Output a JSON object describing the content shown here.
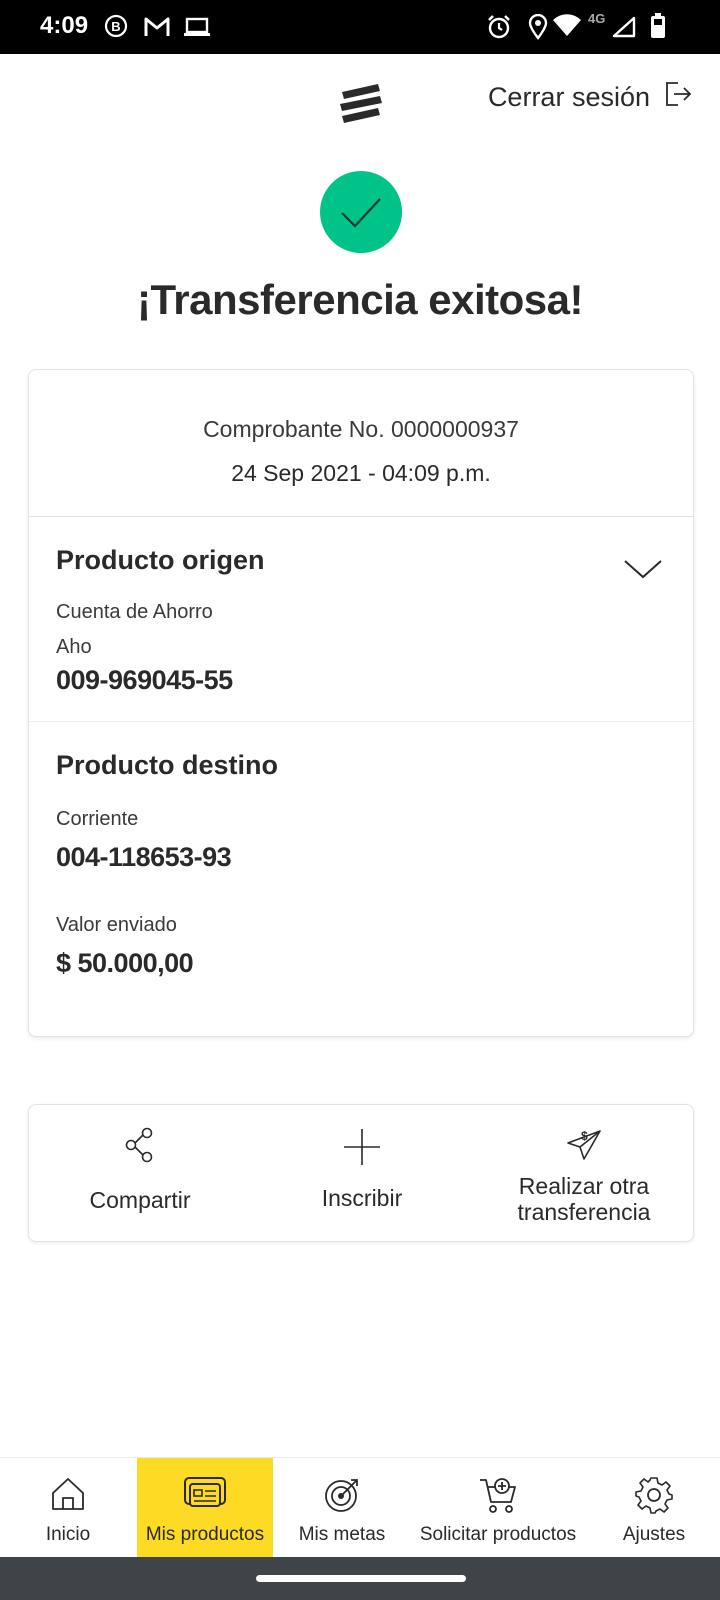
{
  "status_bar": {
    "time": "4:09",
    "network_label": "4G",
    "icons": [
      "b-icon",
      "gmail-icon",
      "laptop-icon",
      "alarm-icon",
      "location-icon",
      "wifi-icon",
      "signal-icon",
      "battery-icon"
    ]
  },
  "header": {
    "logo_icon": "bank-logo-icon",
    "logout_label": "Cerrar sesión",
    "logout_icon": "logout-icon"
  },
  "success": {
    "title": "¡Transferencia exitosa!",
    "icon": "check-icon",
    "color": "#00c389"
  },
  "receipt": {
    "voucher_label": "Comprobante No. 0000000937",
    "date": "24 Sep 2021 - 04:09 p.m.",
    "origin": {
      "title": "Producto origen",
      "account_type": "Cuenta de Ahorro",
      "account_alias": "Aho",
      "account_number": "009-969045-55"
    },
    "destination": {
      "title": "Producto destino",
      "account_type": "Corriente",
      "account_number": "004-118653-93"
    },
    "amount_label": "Valor enviado",
    "amount_value": "$ 50.000,00"
  },
  "actions": [
    {
      "label": "Compartir",
      "icon": "share-icon"
    },
    {
      "label": "Inscribir",
      "icon": "plus-icon"
    },
    {
      "label": "Realizar otra transferencia",
      "icon": "send-money-icon"
    }
  ],
  "bottom_nav": {
    "active_color": "#fdda24",
    "items": [
      {
        "label": "Inicio",
        "icon": "home-icon"
      },
      {
        "label": "Mis productos",
        "icon": "cards-icon",
        "active": true
      },
      {
        "label": "Mis metas",
        "icon": "target-icon"
      },
      {
        "label": "Solicitar productos",
        "icon": "cart-plus-icon"
      },
      {
        "label": "Ajustes",
        "icon": "gear-icon"
      }
    ]
  }
}
